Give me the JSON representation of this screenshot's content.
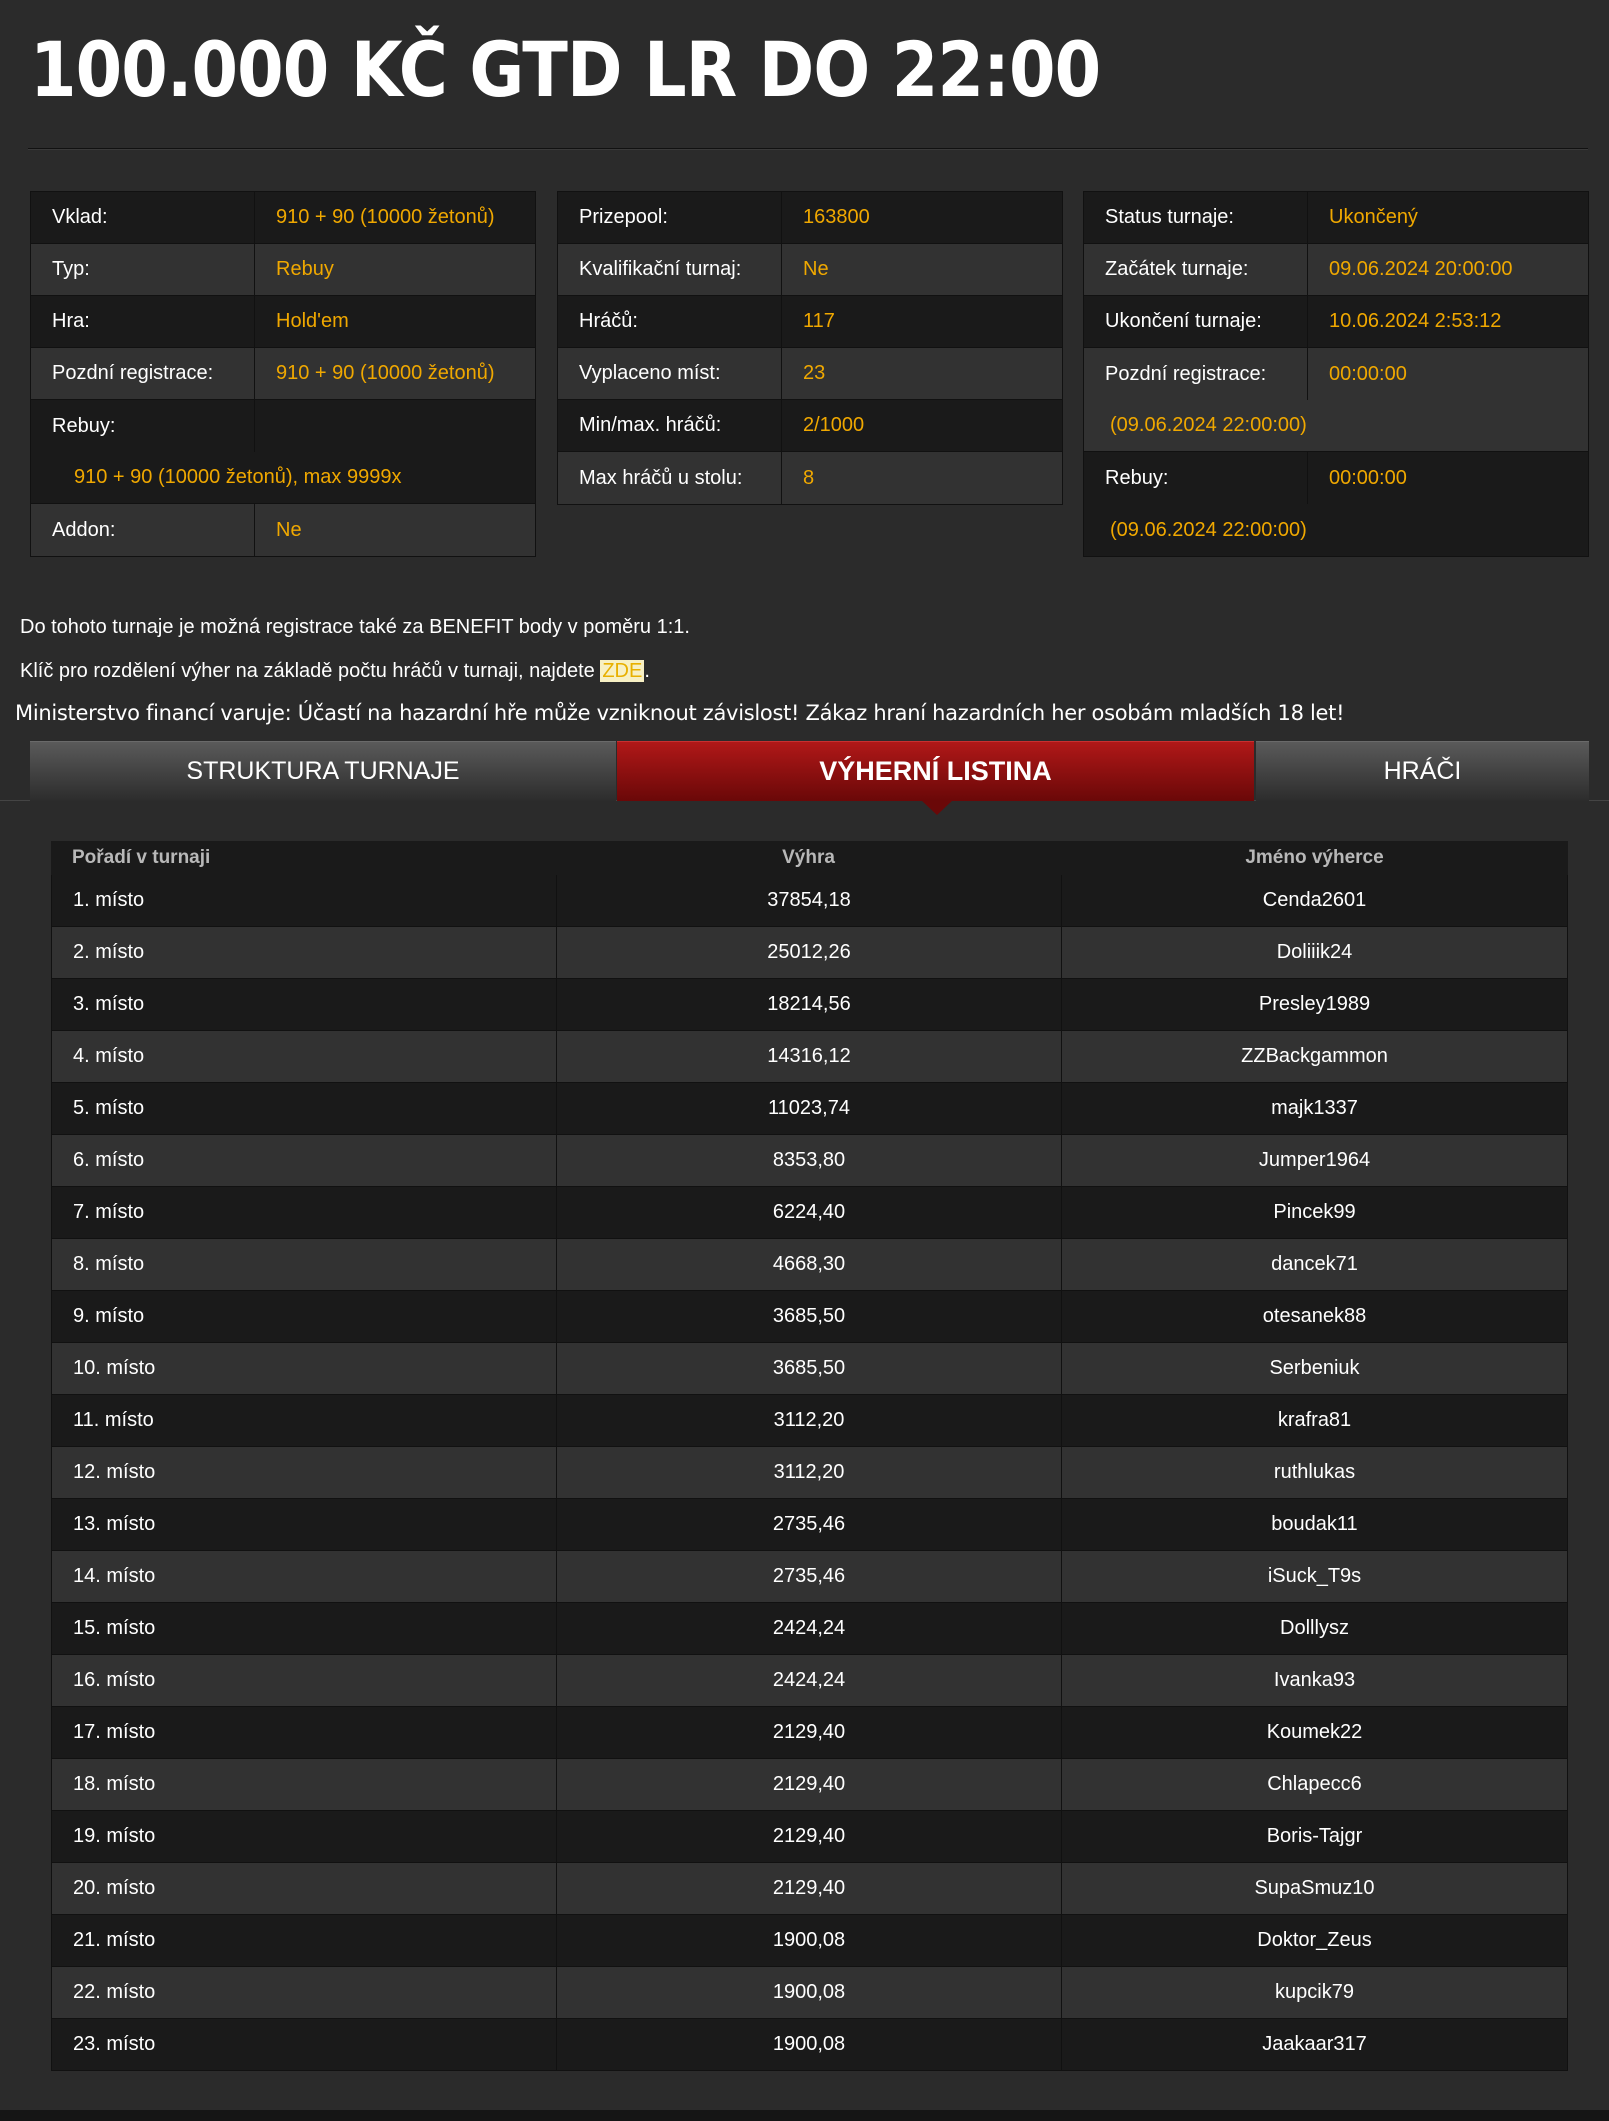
{
  "title": "100.000 KČ GTD LR DO 22:00",
  "info_left": {
    "vklad_label": "Vklad:",
    "vklad_value": "910 + 90 (10000 žetonů)",
    "typ_label": "Typ:",
    "typ_value": "Rebuy",
    "hra_label": "Hra:",
    "hra_value": "Hold'em",
    "pozdni_label": "Pozdní registrace:",
    "pozdni_value": "910 + 90 (10000 žetonů)",
    "rebuy_label": "Rebuy:",
    "rebuy_value": "910 + 90 (10000 žetonů), max 9999x",
    "addon_label": "Addon:",
    "addon_value": "Ne"
  },
  "info_mid": {
    "prizepool_label": "Prizepool:",
    "prizepool_value": "163800",
    "kvalif_label": "Kvalifikační turnaj:",
    "kvalif_value": "Ne",
    "hracu_label": "Hráčů:",
    "hracu_value": "117",
    "vyplaceno_label": "Vyplaceno míst:",
    "vyplaceno_value": "23",
    "minmax_label": "Min/max. hráčů:",
    "minmax_value": "2/1000",
    "maxstul_label": "Max hráčů u stolu:",
    "maxstul_value": "8"
  },
  "info_right": {
    "status_label": "Status turnaje:",
    "status_value": "Ukončený",
    "zacatek_label": "Začátek turnaje:",
    "zacatek_value": "09.06.2024 20:00:00",
    "ukonceni_label": "Ukončení turnaje:",
    "ukonceni_value": "10.06.2024 2:53:12",
    "pozdni_label": "Pozdní registrace:",
    "pozdni_value": "00:00:00",
    "pozdni_date": "(09.06.2024 22:00:00)",
    "rebuy_label": "Rebuy:",
    "rebuy_value": "00:00:00",
    "rebuy_date": "(09.06.2024 22:00:00)"
  },
  "notes": {
    "benefit": "Do tohoto turnaje je možná registrace také za BENEFIT body v poměru 1:1.",
    "klic_prefix": "Klíč pro rozdělení výher na základě počtu hráčů v turnaji, najdete ",
    "klic_link": "ZDE",
    "klic_suffix": ".",
    "warning": "Ministerstvo financí varuje: Účastí na hazardní hře může vzniknout závislost! Zákaz hraní hazardních her osobám mladších 18 let!"
  },
  "tabs": {
    "structure": "STRUKTURA TURNAJE",
    "winners": "VÝHERNÍ LISTINA",
    "players": "HRÁČI"
  },
  "results": {
    "headers": {
      "place": "Pořadí v turnaji",
      "prize": "Výhra",
      "name": "Jméno výherce"
    },
    "rows": [
      {
        "place": "1. místo",
        "prize": "37854,18",
        "name": "Cenda2601"
      },
      {
        "place": "2. místo",
        "prize": "25012,26",
        "name": "Doliiik24"
      },
      {
        "place": "3. místo",
        "prize": "18214,56",
        "name": "Presley1989"
      },
      {
        "place": "4. místo",
        "prize": "14316,12",
        "name": "ZZBackgammon"
      },
      {
        "place": "5. místo",
        "prize": "11023,74",
        "name": "majk1337"
      },
      {
        "place": "6. místo",
        "prize": "8353,80",
        "name": "Jumper1964"
      },
      {
        "place": "7. místo",
        "prize": "6224,40",
        "name": "Pincek99"
      },
      {
        "place": "8. místo",
        "prize": "4668,30",
        "name": "dancek71"
      },
      {
        "place": "9. místo",
        "prize": "3685,50",
        "name": "otesanek88"
      },
      {
        "place": "10. místo",
        "prize": "3685,50",
        "name": "Serbeniuk"
      },
      {
        "place": "11. místo",
        "prize": "3112,20",
        "name": "krafra81"
      },
      {
        "place": "12. místo",
        "prize": "3112,20",
        "name": "ruthlukas"
      },
      {
        "place": "13. místo",
        "prize": "2735,46",
        "name": "boudak11"
      },
      {
        "place": "14. místo",
        "prize": "2735,46",
        "name": "iSuck_T9s"
      },
      {
        "place": "15. místo",
        "prize": "2424,24",
        "name": "Dolllysz"
      },
      {
        "place": "16. místo",
        "prize": "2424,24",
        "name": "Ivanka93"
      },
      {
        "place": "17. místo",
        "prize": "2129,40",
        "name": "Koumek22"
      },
      {
        "place": "18. místo",
        "prize": "2129,40",
        "name": "Chlapecc6"
      },
      {
        "place": "19. místo",
        "prize": "2129,40",
        "name": "Boris-Tajgr"
      },
      {
        "place": "20. místo",
        "prize": "2129,40",
        "name": "SupaSmuz10"
      },
      {
        "place": "21. místo",
        "prize": "1900,08",
        "name": "Doktor_Zeus"
      },
      {
        "place": "22. místo",
        "prize": "1900,08",
        "name": "kupcik79"
      },
      {
        "place": "23. místo",
        "prize": "1900,08",
        "name": "Jaakaar317"
      }
    ]
  }
}
